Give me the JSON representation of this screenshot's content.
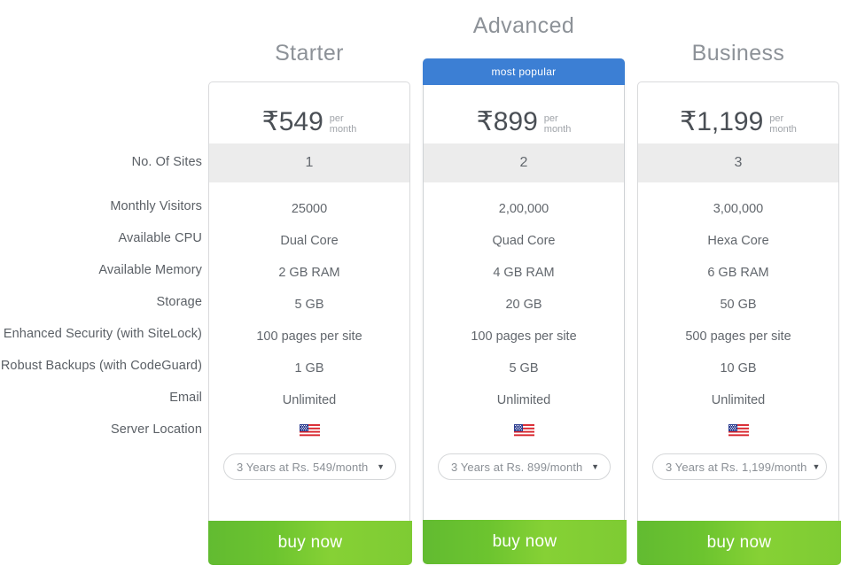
{
  "feature_labels": [
    "No. Of Sites",
    "Monthly Visitors",
    "Available CPU",
    "Available Memory",
    "Storage",
    "Enhanced Security (with SiteLock)",
    "Robust Backups (with CodeGuard)",
    "Email",
    "Server Location"
  ],
  "colors": {
    "popular_banner": "#3c7fd4",
    "buy_button_start": "#62bb31",
    "buy_button_end": "#7ecb33",
    "band_gray": "#ececec",
    "label_text": "#5b6066",
    "value_text": "#62676d",
    "title_text": "#8d9298"
  },
  "plans": [
    {
      "title": "Starter",
      "badge": null,
      "price": "₹549",
      "period_line1": "per",
      "period_line2": "month",
      "sites": "1",
      "values": [
        "25000",
        "Dual Core",
        "2 GB RAM",
        "5 GB",
        "100 pages per site",
        "1 GB",
        "Unlimited"
      ],
      "server_location_icon": "us-flag-icon",
      "term": "3 Years at Rs. 549/month",
      "term_caret": "▼",
      "buy_label": "buy now"
    },
    {
      "title": "Advanced",
      "badge": "most popular",
      "price": "₹899",
      "period_line1": "per",
      "period_line2": "month",
      "sites": "2",
      "values": [
        "2,00,000",
        "Quad Core",
        "4 GB RAM",
        "20 GB",
        "100 pages per site",
        "5 GB",
        "Unlimited"
      ],
      "server_location_icon": "us-flag-icon",
      "term": "3 Years at Rs. 899/month",
      "term_caret": "▼",
      "buy_label": "buy now"
    },
    {
      "title": "Business",
      "badge": null,
      "price": "₹1,199",
      "period_line1": "per",
      "period_line2": "month",
      "sites": "3",
      "values": [
        "3,00,000",
        "Hexa Core",
        "6 GB RAM",
        "50 GB",
        "500 pages per site",
        "10 GB",
        "Unlimited"
      ],
      "server_location_icon": "us-flag-icon",
      "term": "3 Years at Rs. 1,199/month",
      "term_caret": "▼",
      "buy_label": "buy now"
    }
  ]
}
